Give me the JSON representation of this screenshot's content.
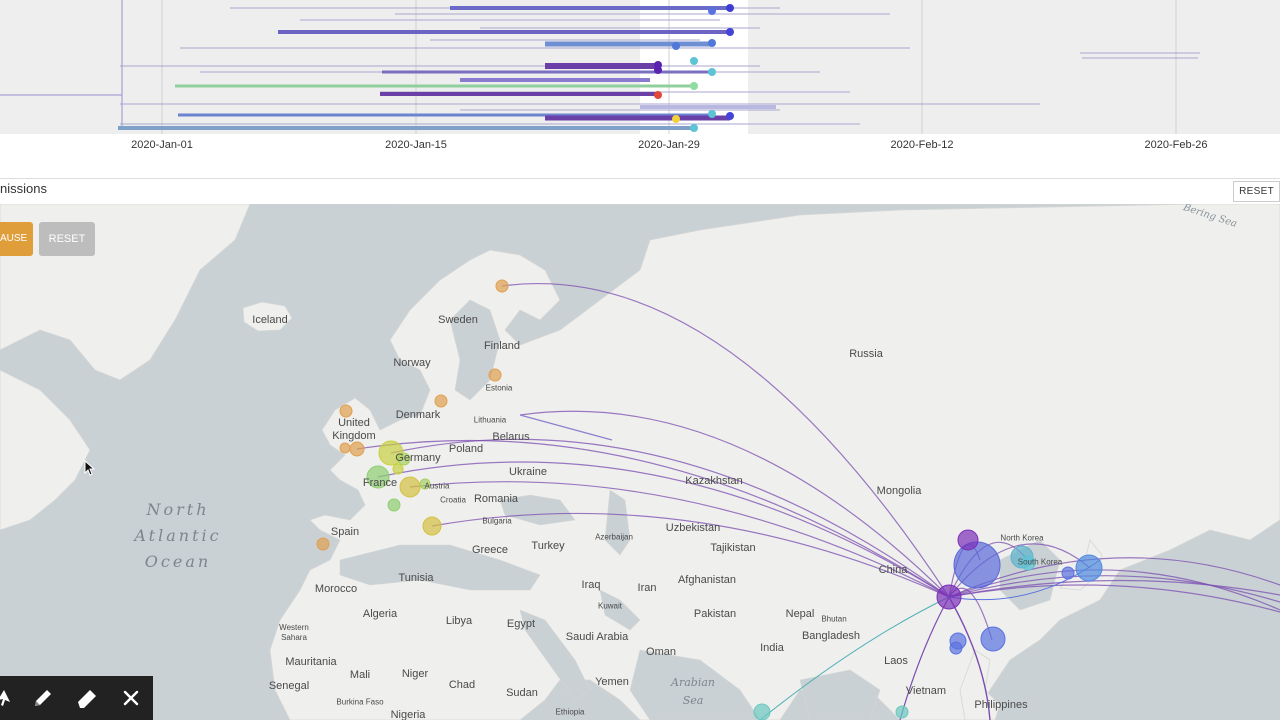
{
  "timeline": {
    "ticks": [
      "2020-Jan-01",
      "2020-Jan-15",
      "2020-Jan-29",
      "2020-Feb-12",
      "2020-Feb-26"
    ]
  },
  "map_header": {
    "title": "nissions",
    "reset_label": "RESET"
  },
  "map_controls": {
    "pause_label": "AUSE",
    "reset_label": "RESET"
  },
  "map_labels": {
    "countries": [
      "Iceland",
      "Sweden",
      "Finland",
      "Norway",
      "Russia",
      "Estonia",
      "Denmark",
      "Lithuania",
      "United Kingdom",
      "Belarus",
      "Poland",
      "Germany",
      "Ukraine",
      "Kazakhstan",
      "Mongolia",
      "France",
      "Austria",
      "Croatia",
      "Romania",
      "Bulgaria",
      "Spain",
      "Greece",
      "Turkey",
      "Azerbaijan",
      "Uzbekistan",
      "Tajikistan",
      "North Korea",
      "China",
      "South Korea",
      "Tunisia",
      "Morocco",
      "Iraq",
      "Iran",
      "Afghanistan",
      "Algeria",
      "Libya",
      "Egypt",
      "Kuwait",
      "Pakistan",
      "Nepal",
      "Bhutan",
      "Western Sahara",
      "Saudi Arabia",
      "Bangladesh",
      "Oman",
      "India",
      "Mauritania",
      "Mali",
      "Niger",
      "Laos",
      "Chad",
      "Sudan",
      "Yemen",
      "Senegal",
      "Vietnam",
      "Philippines",
      "Burkina Faso",
      "Nigeria",
      "Ethiopia"
    ],
    "oceans": [
      "North Atlantic Ocean",
      "Arabian Sea",
      "Bering Sea"
    ]
  },
  "colors": {
    "accent_orange": "#e09e3b",
    "button_gray": "#bdbdbd",
    "toolbar_dark": "#222222",
    "lineage_purple": "#7b4db0",
    "map_water": "#c9d1d5",
    "map_land": "#efefed"
  },
  "icons": [
    "cursor-arrow-icon",
    "pencil-icon",
    "eraser-icon",
    "close-icon",
    "pointer-cursor-icon"
  ]
}
